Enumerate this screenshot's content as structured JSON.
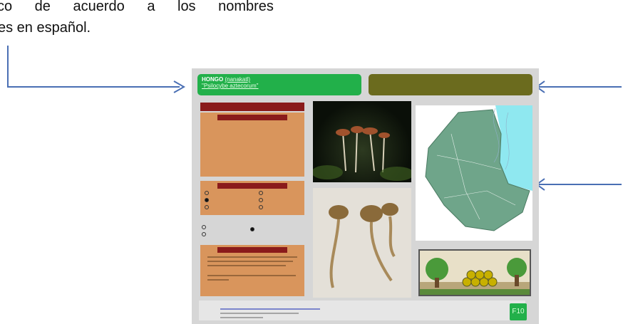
{
  "intro": {
    "line1": "co de acuerdo a los nombres",
    "line2": "es en español."
  },
  "slide": {
    "header": {
      "title": "HONGO",
      "common_name": "(nanakatl)",
      "scientific_name": "\"Psilocybe aztecorum\""
    },
    "header2": {
      "text_a": "",
      "text_b": ""
    },
    "description_bar": "",
    "card1": {
      "bar": "",
      "rows": [
        {
          "label": "",
          "value": ""
        },
        {
          "label": "",
          "value": ""
        },
        {
          "label": "",
          "value": ""
        },
        {
          "label": "",
          "value": ""
        },
        {
          "label": "",
          "value": ""
        },
        {
          "label": "",
          "value": ""
        }
      ]
    },
    "card2": {
      "bar": ""
    },
    "card3": {
      "bar": ""
    },
    "footer": {
      "title": "",
      "r1_prefix": "",
      "r1_link": "",
      "r2": "",
      "r3": ""
    },
    "badge": "F10"
  },
  "colors": {
    "arrow": "#4a6fb4",
    "green_header": "#22b04a",
    "olive_header": "#6b6b1e",
    "red_bar": "#8a1b1b",
    "card": "#d9955c"
  }
}
